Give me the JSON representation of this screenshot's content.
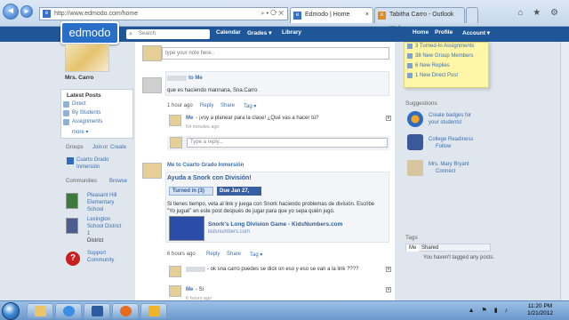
{
  "browser": {
    "url": "http://www.edmodo.com/home",
    "tabs": [
      {
        "label": "Edmodo | Home",
        "active": true
      },
      {
        "label": "Tabitha Carro - Outlook Web ...",
        "active": false
      }
    ]
  },
  "topnav": {
    "logo": "edmodo",
    "search_placeholder": "Search",
    "items": [
      "Calendar",
      "Grades ▾",
      "Library"
    ],
    "right_items": [
      "Home",
      "Profile",
      "Account ▾"
    ]
  },
  "sidebar": {
    "user_name": "Mrs. Carro",
    "panel_title": "Latest Posts",
    "panel_items": [
      "Direct",
      "By Students",
      "Assignments"
    ],
    "more": "more ▾",
    "groups_title": "Groups",
    "groups_join": "Join",
    "groups_or": "or",
    "groups_create": "Create",
    "group_line1": "Cuarto Grado",
    "group_line2": "Inmersión",
    "communities_title": "Communities",
    "communities_browse": "Browse",
    "communities": [
      {
        "lines": [
          "Pleasant Hill",
          "Elementary",
          "School"
        ]
      },
      {
        "lines": [
          "Lexington",
          "School District",
          "1",
          "District"
        ]
      },
      {
        "lines": [
          "Support",
          "Community"
        ]
      }
    ]
  },
  "feed": {
    "note_placeholder": "type your note here..",
    "post1": {
      "to": "to Me",
      "text": "que es haciendo mannana, Sna.Carro",
      "time": "1 hour ago",
      "actions": [
        "Reply",
        "Share",
        "Tag ▾"
      ],
      "reply_name": "Me",
      "reply_text": "- ¡voy a planear para la clase! ¿Qué vas a hacer tú?",
      "reply_time": "54 minutes ago",
      "reply_placeholder": "Type a reply..."
    },
    "post2": {
      "meta": "Me to Cuarto Grado Inmersión",
      "title": "Ayuda a Snork con División!",
      "turned_in": "Turned in (3)",
      "due": "Due Jan 27, 2012",
      "body1": "Si tienes tiempo, veta al link y juega con Snork haciendo problemas de división. Escribe",
      "body2": "\"Yo jugué\" en este post después de jugar para que yo sepa quién jugó.",
      "link_title": "Snork's Long Division Game - KidsNumbers.com",
      "link_sub": "kidsnumbers.com",
      "time": "6 hours ago",
      "actions": [
        "Reply",
        "Share",
        "Tag ▾"
      ],
      "reply1_text": "- ok sna carro puedes se dick on eso y eso se van a la link ????",
      "reply2_name": "Me",
      "reply2_text": "- Sí",
      "reply2_time": "6 hours ago"
    }
  },
  "right": {
    "sticky": [
      "3 Turned-In Assignments",
      "38 New Group Members",
      "6 New Replies",
      "1 New Direct Post"
    ],
    "suggestions_title": "Suggestions",
    "suggestions": [
      {
        "lines": [
          "Create badges for",
          "your students!"
        ]
      },
      {
        "lines": [
          "College Readiness",
          "Follow"
        ]
      },
      {
        "lines": [
          "Mrs. Mary Bryant",
          "Connect"
        ]
      }
    ],
    "tags_title": "Tags",
    "tag_tabs": [
      "Me",
      "Shared"
    ],
    "tags_empty": "You haven't tagged any posts."
  },
  "taskbar": {
    "time": "11:20 PM",
    "date": "1/21/2012"
  },
  "colors": {
    "topnav": "#1f5698",
    "link": "#3a6fb0",
    "sticky": "#fff6a8"
  }
}
